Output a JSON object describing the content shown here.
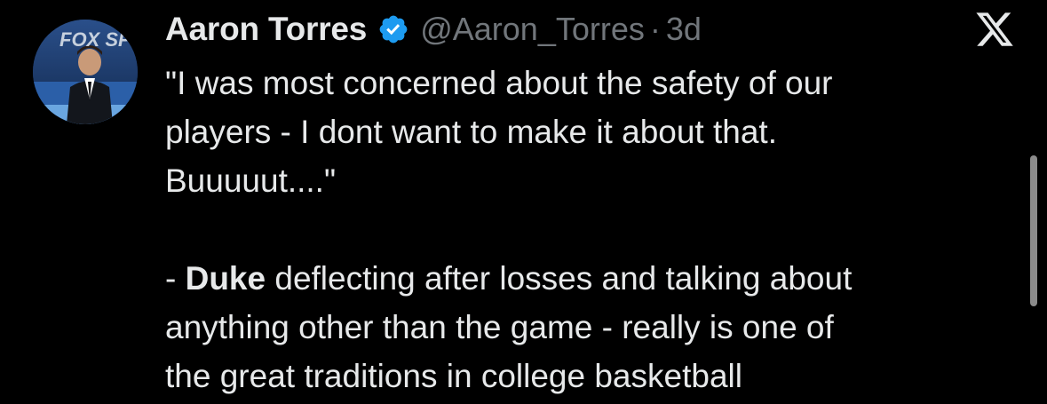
{
  "author": {
    "display_name": "Aaron Torres",
    "handle": "@Aaron_Torres",
    "separator": "·",
    "time": "3d",
    "avatar_text": "FOX SPORTS",
    "verified_color": "#1d9bf0"
  },
  "tweet": {
    "line1": "\"I was most concerned about the safety of our",
    "line2": "players - I dont want to make it about that.",
    "line3": "Buuuuut....\"",
    "quote_prefix": "- ",
    "quote_bold": "Duke",
    "quote_rest": " deflecting after losses and talking about",
    "line5": "anything other than the game - really is one of",
    "line6": "the great traditions in college basketball"
  },
  "icons": {
    "brand": "x-logo-icon",
    "verified": "verified-badge-icon"
  },
  "colors": {
    "background": "#000000",
    "text": "#e7e9ea",
    "muted": "#71767b",
    "verified": "#1d9bf0"
  }
}
